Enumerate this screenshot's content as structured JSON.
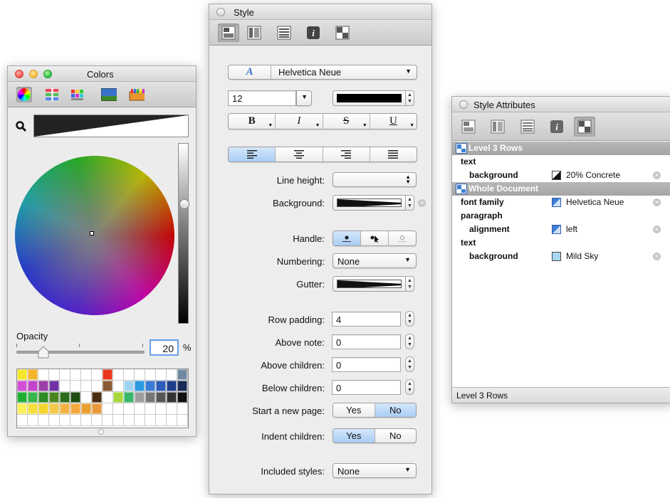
{
  "colors_panel": {
    "title": "Colors",
    "toolbar_icons": [
      "color-wheel-icon",
      "color-sliders-icon",
      "color-palettes-icon",
      "image-palettes-icon",
      "crayons-icon"
    ],
    "opacity_label": "Opacity",
    "opacity_value": "20",
    "opacity_unit": "%",
    "opacity_fraction": 0.2,
    "swatches": [
      [
        "#f6e62a",
        "#f5b32a",
        "",
        "",
        "",
        "",
        "",
        "",
        "#e8361f",
        "",
        "",
        "",
        "",
        "",
        "",
        "#6f8aa0"
      ],
      [
        "#d24fd6",
        "#c144c9",
        "#9a3fa7",
        "#7032a5",
        "",
        "",
        "",
        "",
        "#8a5a32",
        "",
        "#9fd4f0",
        "#2b9ae3",
        "#3a7bd5",
        "#2e5bb8",
        "#1e3e8a",
        "#182a55"
      ],
      [
        "#1fae34",
        "#35b54a",
        "#2d8b22",
        "#4b8520",
        "#2b6c1c",
        "#1e4d12",
        "",
        "#4b2e12",
        "",
        "#a5d63a",
        "#3ab66b",
        "#9e9e9e",
        "#777777",
        "#555555",
        "#333333",
        "#111111"
      ],
      [
        "#fbef5c",
        "#f8de3c",
        "#f4d52c",
        "#f2c84a",
        "#f2b243",
        "#f4a83d",
        "#e8a030",
        "#e89a3b",
        "",
        "",
        "",
        "",
        "",
        "",
        "",
        ""
      ],
      [
        "",
        "",
        "",
        "",
        "",
        "",
        "",
        "",
        "",
        "",
        "",
        "",
        "",
        "",
        "",
        ""
      ]
    ]
  },
  "style_panel": {
    "title": "Style",
    "toolbar_icons": [
      "style-attributes-icon",
      "column-icon",
      "row-list-icon",
      "info-icon",
      "document-style-icon"
    ],
    "font_family": "Helvetica Neue",
    "font_size": "12",
    "bold_label": "B",
    "italic_label": "I",
    "strike_label": "S",
    "underline_label": "U",
    "line_height_label": "Line height:",
    "background_label": "Background:",
    "handle_label": "Handle:",
    "numbering_label": "Numbering:",
    "numbering_value": "None",
    "gutter_label": "Gutter:",
    "row_padding_label": "Row padding:",
    "row_padding_value": "4",
    "above_note_label": "Above note:",
    "above_note_value": "0",
    "above_children_label": "Above children:",
    "above_children_value": "0",
    "below_children_label": "Below children:",
    "below_children_value": "0",
    "start_new_page_label": "Start a new page:",
    "indent_children_label": "Indent children:",
    "yes_label": "Yes",
    "no_label": "No",
    "start_new_page_selected": "No",
    "indent_children_selected": "Yes",
    "included_styles_label": "Included styles:",
    "included_styles_value": "None"
  },
  "attrs_panel": {
    "title": "Style Attributes",
    "group1": "Level 3 Rows",
    "g1_text": "text",
    "g1_background": "background",
    "g1_background_value": "20% Concrete",
    "group2": "Whole Document",
    "font_family_key": "font family",
    "font_family_value": "Helvetica Neue",
    "paragraph_key": "paragraph",
    "alignment_key": "alignment",
    "alignment_value": "left",
    "g2_text": "text",
    "g2_background": "background",
    "g2_background_value": "Mild Sky",
    "status": "Level 3 Rows",
    "accent": "#3f7fd6"
  }
}
